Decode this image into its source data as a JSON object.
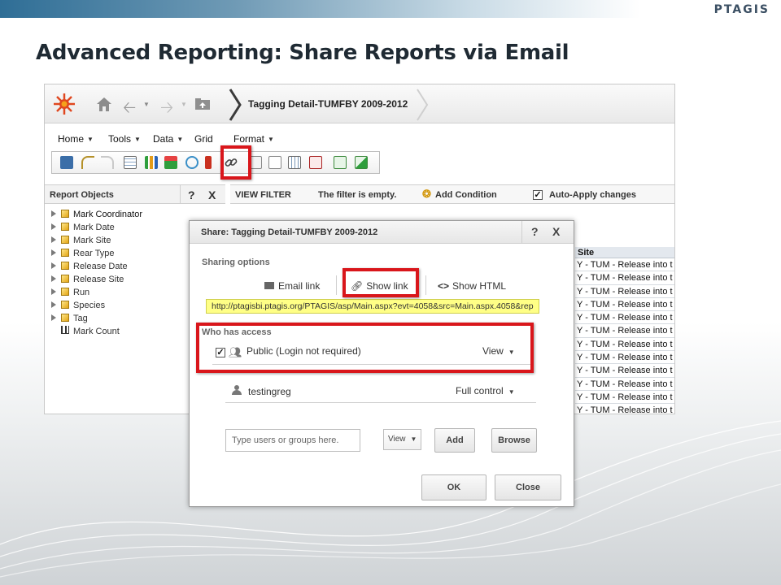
{
  "slide": {
    "title": "Advanced Reporting: Share Reports via Email",
    "brand": "PTAGIS",
    "accent_color": "#d9161b"
  },
  "app": {
    "report_title": "Tagging Detail-TUMFBY 2009-2012",
    "menu": [
      {
        "label": "Home"
      },
      {
        "label": "Tools"
      },
      {
        "label": "Data"
      },
      {
        "label": "Grid"
      },
      {
        "label": "Format"
      }
    ],
    "left_pane": {
      "title": "Report Objects",
      "help": "?",
      "close": "X",
      "items": [
        {
          "label": "Mark Coordinator",
          "icon": "attribute-cube-icon",
          "expandable": true
        },
        {
          "label": "Mark Date",
          "icon": "attribute-cube-icon",
          "expandable": true
        },
        {
          "label": "Mark Site",
          "icon": "attribute-cube-icon",
          "expandable": true
        },
        {
          "label": "Rear Type",
          "icon": "attribute-cube-icon",
          "expandable": true
        },
        {
          "label": "Release Date",
          "icon": "attribute-cube-icon",
          "expandable": true
        },
        {
          "label": "Release Site",
          "icon": "attribute-cube-icon",
          "expandable": true
        },
        {
          "label": "Run",
          "icon": "attribute-cube-icon",
          "expandable": true
        },
        {
          "label": "Species",
          "icon": "attribute-cube-icon",
          "expandable": true
        },
        {
          "label": "Tag",
          "icon": "attribute-cube-icon",
          "expandable": true
        },
        {
          "label": "Mark Count",
          "icon": "metric-icon",
          "expandable": false
        }
      ]
    },
    "filter": {
      "label": "VIEW FILTER",
      "status": "The filter is empty.",
      "add_condition": "Add Condition",
      "auto_apply": "Auto-Apply changes",
      "auto_apply_checked": true
    },
    "grid": {
      "header": "Site",
      "rows": [
        "Y - TUM - Release into t",
        "Y - TUM - Release into t",
        "Y - TUM - Release into t",
        "Y - TUM - Release into t",
        "Y - TUM - Release into t",
        "Y - TUM - Release into t",
        "Y - TUM - Release into t",
        "Y - TUM - Release into t",
        "Y - TUM - Release into t",
        "Y - TUM - Release into t",
        "Y - TUM - Release into t",
        "Y - TUM - Release into t"
      ]
    }
  },
  "dialog": {
    "title": "Share: Tagging Detail-TUMFBY 2009-2012",
    "help": "?",
    "close": "X",
    "sharing_options_label": "Sharing options",
    "email_link": "Email link",
    "show_link": "Show link",
    "show_html": "Show HTML",
    "url": "http://ptagisbi.ptagis.org/PTAGIS/asp/Main.aspx?evt=4058&src=Main.aspx.4058&rep",
    "who_has_access": "Who has access",
    "access": [
      {
        "name": "Public (Login not required)",
        "permission": "View",
        "checked": true
      },
      {
        "name": "testingreg",
        "permission": "Full control"
      }
    ],
    "add_input_placeholder": "Type users or groups here.",
    "add_permission": "View",
    "add_button": "Add",
    "browse_button": "Browse",
    "ok_button": "OK",
    "close_button": "Close"
  }
}
